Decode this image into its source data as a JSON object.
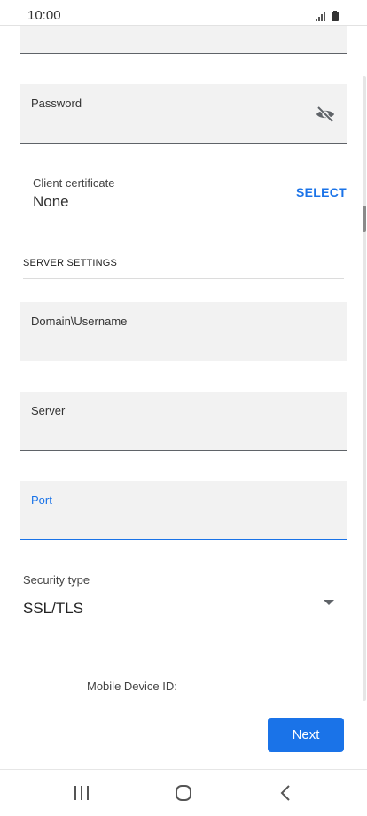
{
  "status_bar": {
    "time": "10:00",
    "signal_icon": "signal-icon",
    "battery_icon": "battery-icon"
  },
  "password_field": {
    "label": "Password",
    "toggle_icon": "eye-off-icon"
  },
  "client_certificate": {
    "label": "Client certificate",
    "value": "None",
    "action_label": "SELECT"
  },
  "server_settings": {
    "title": "SERVER SETTINGS",
    "domain_label": "Domain\\Username",
    "server_label": "Server",
    "port_label": "Port"
  },
  "security": {
    "label": "Security type",
    "value": "SSL/TLS"
  },
  "device": {
    "label": "Mobile Device ID:"
  },
  "actions": {
    "next_label": "Next"
  },
  "nav": {
    "recents_icon": "recents-icon",
    "home_icon": "home-icon",
    "back_icon": "back-icon"
  },
  "colors": {
    "accent": "#1a73e8",
    "field_bg": "#f2f2f2",
    "field_border": "#5f6368"
  }
}
